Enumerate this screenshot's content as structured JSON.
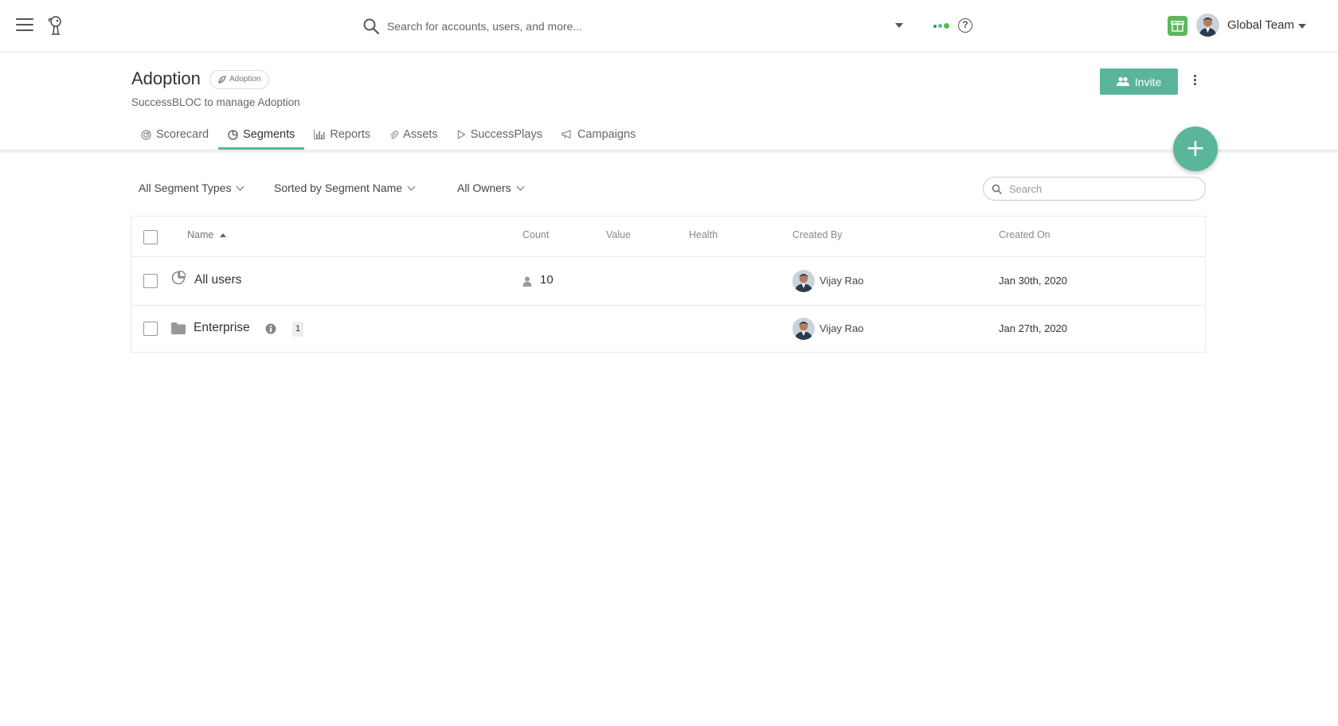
{
  "topbar": {
    "search_placeholder": "Search for accounts, users, and more...",
    "team_name": "Global Team"
  },
  "header": {
    "title": "Adoption",
    "badge": "Adoption",
    "subtitle": "SuccessBLOC to manage Adoption",
    "invite_label": "Invite",
    "accent_color": "#5bb59b"
  },
  "tabs": [
    {
      "label": "Scorecard",
      "icon": "scorecard-icon"
    },
    {
      "label": "Segments",
      "icon": "segments-icon",
      "active": true
    },
    {
      "label": "Reports",
      "icon": "bar-chart-icon"
    },
    {
      "label": "Assets",
      "icon": "paperclip-icon"
    },
    {
      "label": "SuccessPlays",
      "icon": "play-icon"
    },
    {
      "label": "Campaigns",
      "icon": "megaphone-icon"
    }
  ],
  "filters": {
    "segment_types": "All Segment Types",
    "sort": "Sorted by Segment Name",
    "owners": "All Owners",
    "search_placeholder": "Search"
  },
  "table": {
    "columns": [
      "Name",
      "Count",
      "Value",
      "Health",
      "Created By",
      "Created On"
    ],
    "rows": [
      {
        "icon": "pie-chart-icon",
        "name": "All users",
        "count": "10",
        "created_by": "Vijay Rao",
        "created_on": "Jan 30th, 2020"
      },
      {
        "icon": "folder-icon",
        "name": "Enterprise",
        "badge": "1",
        "created_by": "Vijay Rao",
        "created_on": "Jan 27th, 2020"
      }
    ]
  }
}
